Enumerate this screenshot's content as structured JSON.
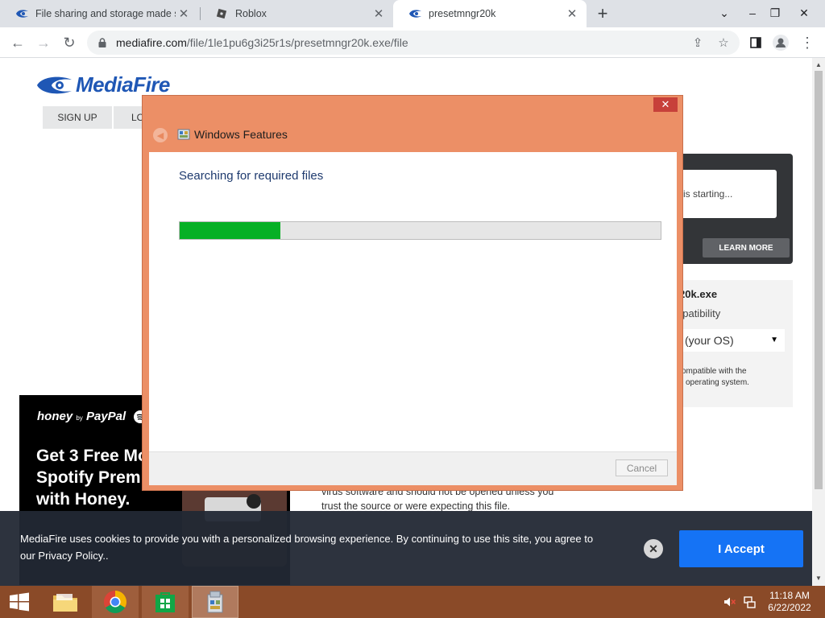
{
  "browser": {
    "tabs": [
      {
        "title": "File sharing and storage made si",
        "favicon": "mediafire-icon",
        "active": false
      },
      {
        "title": "Roblox",
        "favicon": "roblox-icon",
        "active": false
      },
      {
        "title": "presetmngr20k",
        "favicon": "mediafire-icon",
        "active": true
      }
    ],
    "new_tab": "+",
    "url_host": "mediafire.com",
    "url_path": "/file/1le1pu6g3i25r1s/presetmngr20k.exe/file"
  },
  "page": {
    "logo_text": "MediaFire",
    "sign_up": "SIGN UP",
    "login_partial": "LO",
    "download_status": "is starting...",
    "learn_more": "LEARN MORE",
    "file_name_partial": "r20k.exe",
    "compat_partial": "npatibility",
    "os_select_partial": "(your OS)",
    "compat_note_line1": "ompatible with the",
    "compat_note_line2": "l operating system.",
    "warning_line1": "virus software and should not be opened unless you",
    "warning_line2": "trust the source or were expecting this file."
  },
  "ad": {
    "brand": "honey",
    "by": "by",
    "paypal": "PayPal",
    "headline_line1": "Get 3 Free Mo",
    "headline_line2": "Spotify Prem",
    "headline_line3": "with Honey."
  },
  "cookie": {
    "message": "MediaFire uses cookies to provide you with a personalized browsing experience. By continuing to use this site, you agree to our Privacy Policy..",
    "close": "✕",
    "accept": "I Accept"
  },
  "dialog": {
    "title": "Windows Features",
    "close": "✕",
    "status": "Searching for required files",
    "progress": 0.21,
    "cancel": "Cancel"
  },
  "taskbar": {
    "time": "11:18 AM",
    "date": "6/22/2022"
  },
  "colors": {
    "dialog_frame": "#ec8f66",
    "progress_fill": "#06b025",
    "taskbar": "#8a4a28",
    "accept_button": "#1573f5"
  }
}
